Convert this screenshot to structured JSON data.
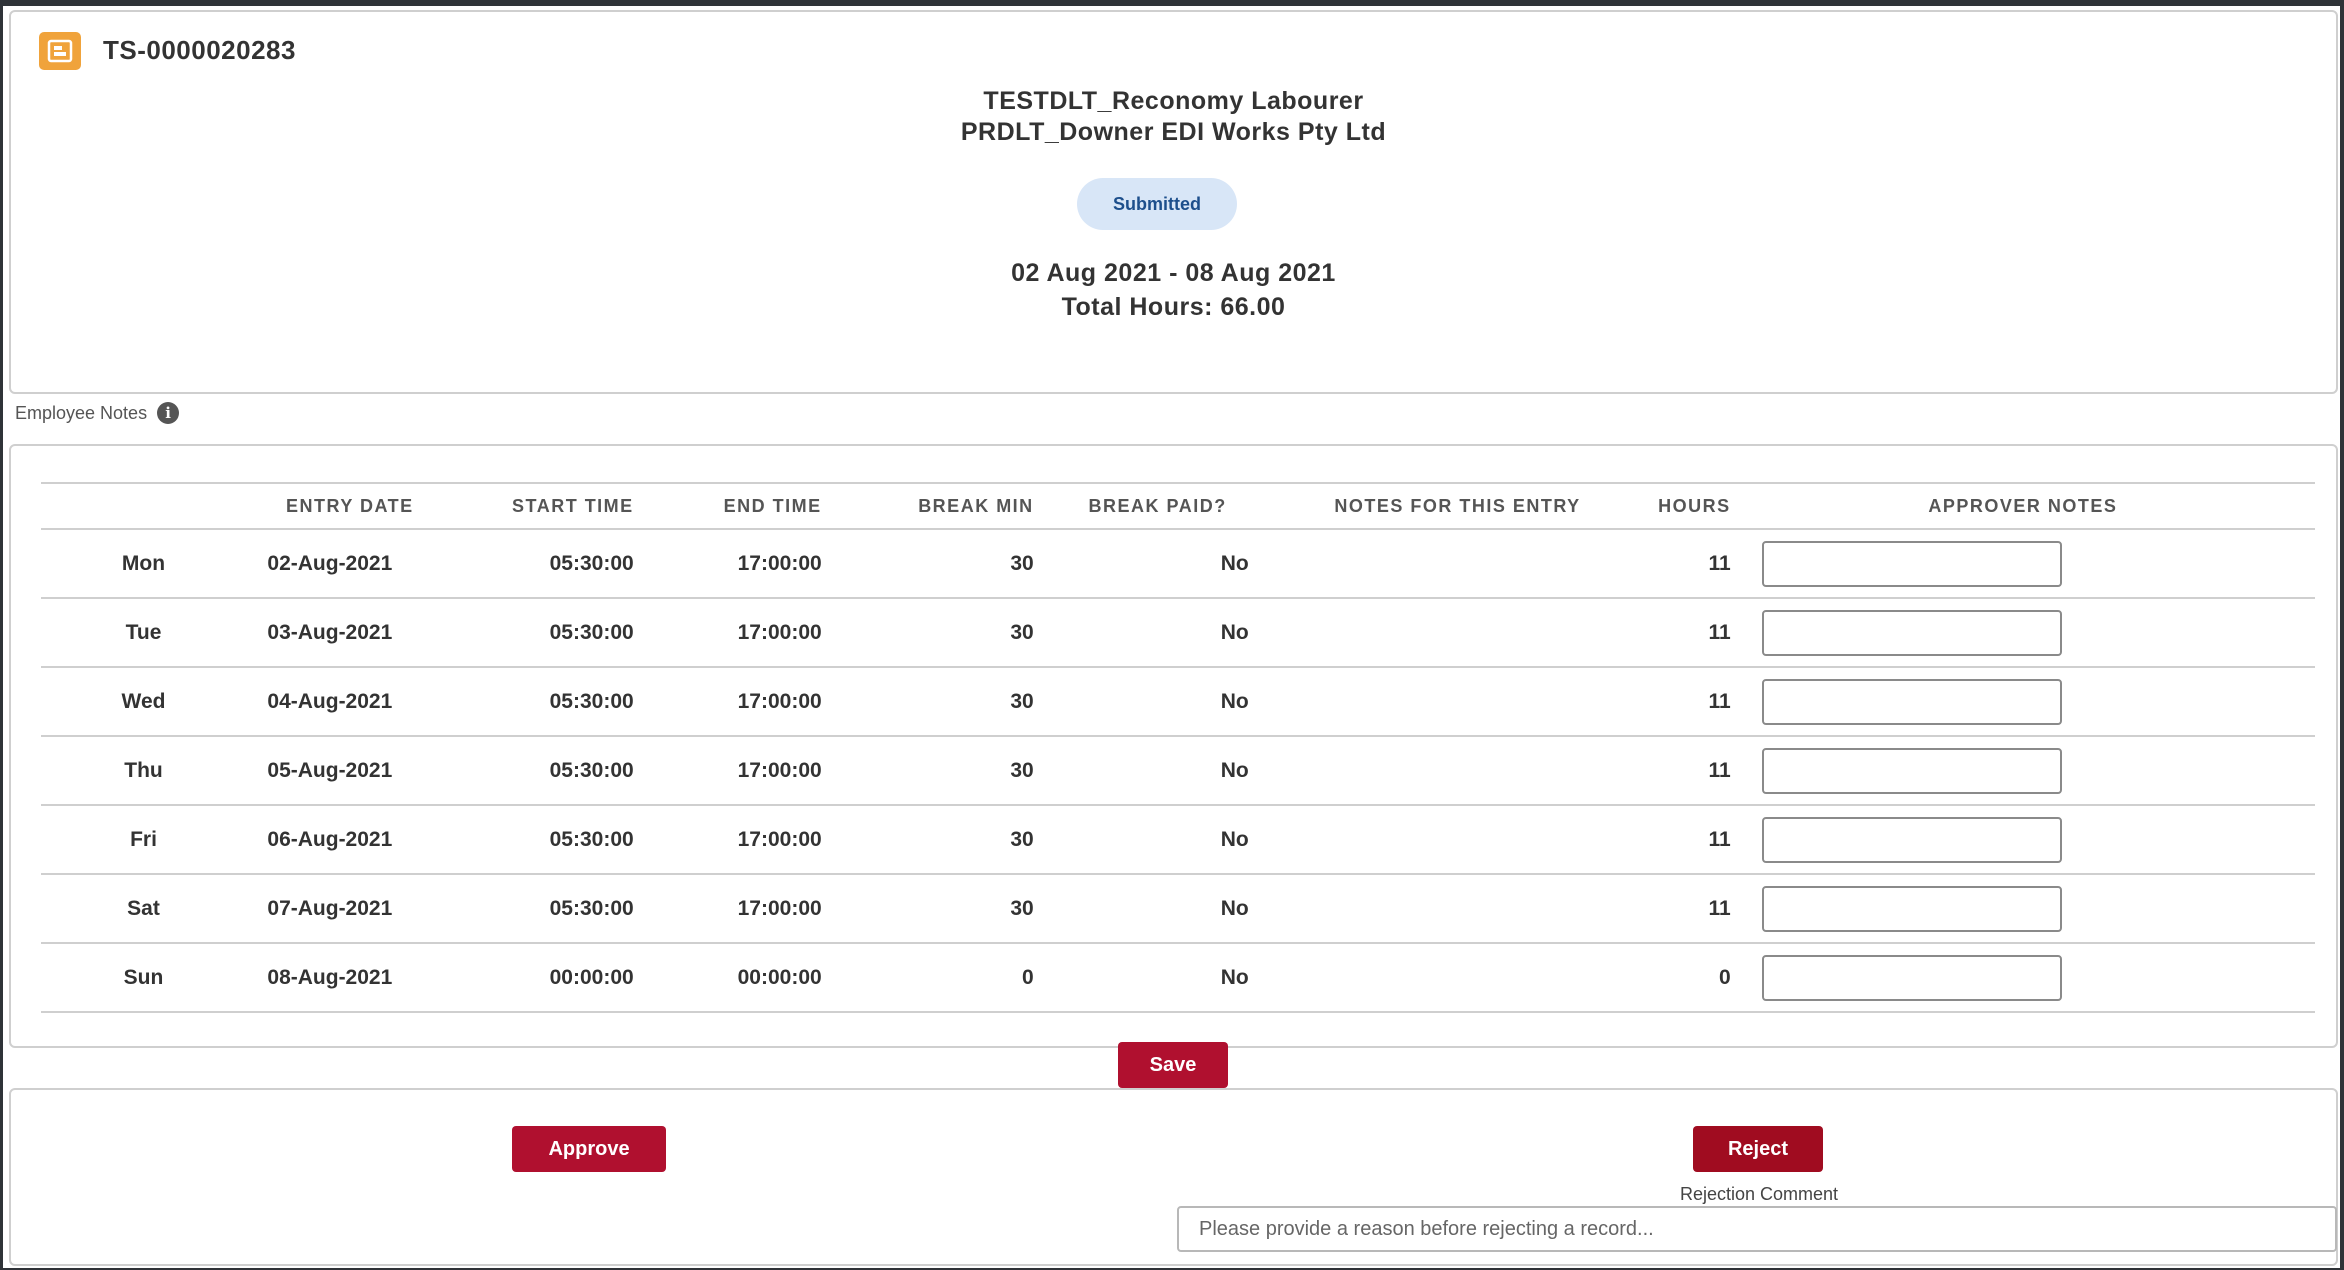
{
  "record": {
    "id": "TS-0000020283",
    "icon": "record-icon",
    "title_line1": "TESTDLT_Reconomy Labourer",
    "title_line2": "PRDLT_Downer EDI Works Pty Ltd",
    "status": "Submitted",
    "period": "02 Aug 2021 - 08 Aug 2021",
    "total_hours": "Total Hours: 66.00"
  },
  "employee_notes": {
    "label": "Employee Notes",
    "icon": "info-icon"
  },
  "table": {
    "headers": {
      "day": "",
      "entry_date": "ENTRY DATE",
      "start_time": "START TIME",
      "end_time": "END TIME",
      "break_min": "BREAK MIN",
      "break_paid": "BREAK PAID?",
      "notes": "NOTES FOR THIS ENTRY",
      "hours": "HOURS",
      "approver_notes": "APPROVER NOTES"
    },
    "rows": [
      {
        "day": "Mon",
        "date": "02-Aug-2021",
        "start": "05:30:00",
        "end": "17:00:00",
        "break_min": "30",
        "break_paid": "No",
        "notes": "",
        "hours": "11",
        "approver_note": ""
      },
      {
        "day": "Tue",
        "date": "03-Aug-2021",
        "start": "05:30:00",
        "end": "17:00:00",
        "break_min": "30",
        "break_paid": "No",
        "notes": "",
        "hours": "11",
        "approver_note": ""
      },
      {
        "day": "Wed",
        "date": "04-Aug-2021",
        "start": "05:30:00",
        "end": "17:00:00",
        "break_min": "30",
        "break_paid": "No",
        "notes": "",
        "hours": "11",
        "approver_note": ""
      },
      {
        "day": "Thu",
        "date": "05-Aug-2021",
        "start": "05:30:00",
        "end": "17:00:00",
        "break_min": "30",
        "break_paid": "No",
        "notes": "",
        "hours": "11",
        "approver_note": ""
      },
      {
        "day": "Fri",
        "date": "06-Aug-2021",
        "start": "05:30:00",
        "end": "17:00:00",
        "break_min": "30",
        "break_paid": "No",
        "notes": "",
        "hours": "11",
        "approver_note": ""
      },
      {
        "day": "Sat",
        "date": "07-Aug-2021",
        "start": "05:30:00",
        "end": "17:00:00",
        "break_min": "30",
        "break_paid": "No",
        "notes": "",
        "hours": "11",
        "approver_note": ""
      },
      {
        "day": "Sun",
        "date": "08-Aug-2021",
        "start": "00:00:00",
        "end": "00:00:00",
        "break_min": "0",
        "break_paid": "No",
        "notes": "",
        "hours": "0",
        "approver_note": ""
      }
    ]
  },
  "actions": {
    "save_label": "Save",
    "approve_label": "Approve",
    "reject_label": "Reject",
    "rejection_comment_label": "Rejection Comment",
    "rejection_placeholder": "Please provide a reason before rejecting a record..."
  },
  "colors": {
    "primary_button": "#b0102f",
    "status_pill_bg": "#d8e6f7",
    "status_pill_text": "#1d4f8c",
    "record_icon_bg": "#f0a33b"
  }
}
